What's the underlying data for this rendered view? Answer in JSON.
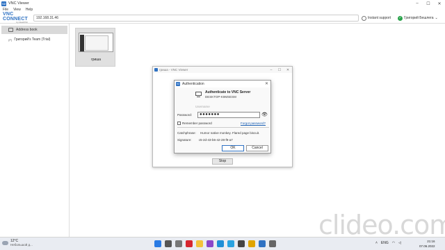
{
  "window": {
    "title": "VNC Viewer",
    "logo": "V2"
  },
  "menu": [
    "File",
    "View",
    "Help"
  ],
  "toolbar": {
    "brand_main": "VNC CONNECT",
    "brand_sub": "by RealVNC",
    "address": "192.168.31.46",
    "instant_support": "Instant support",
    "user_name": "Григорий Бешлега"
  },
  "sidebar": {
    "items": [
      {
        "label": "Address book"
      },
      {
        "label": "Григорий's Team (Trial)",
        "badge": "(P)"
      }
    ]
  },
  "thumbnail": {
    "label": "гриша"
  },
  "session": {
    "title": "гриша - VNC Viewer",
    "stop_label": "Stop"
  },
  "auth": {
    "title": "Authentication",
    "heading": "Authenticate to VNC Server",
    "server": "DESKTOP-K9MSESM",
    "username_placeholder": "Username",
    "password_label": "Password:",
    "password_value": "●●●●●●●",
    "remember_label": "Remember password",
    "forgot_label": "Forgot password?",
    "catchphrase_label": "Catchphrase:",
    "catchphrase_value": "Humor native monkey. Flared page biscuit.",
    "signature_label": "Signature:",
    "signature_value": "c5-2d-43-b6-42-28-f9-a7",
    "ok_label": "OK",
    "cancel_label": "Cancel"
  },
  "taskbar": {
    "weather_temp": "12°C",
    "weather_desc": "Небольшой д...",
    "lang": "ENG",
    "time": "21:16",
    "date": "07.06.2022"
  },
  "watermark": "clideo.com",
  "colors": {
    "accent": "#2f72c3",
    "user_status": "#2aa34b"
  }
}
